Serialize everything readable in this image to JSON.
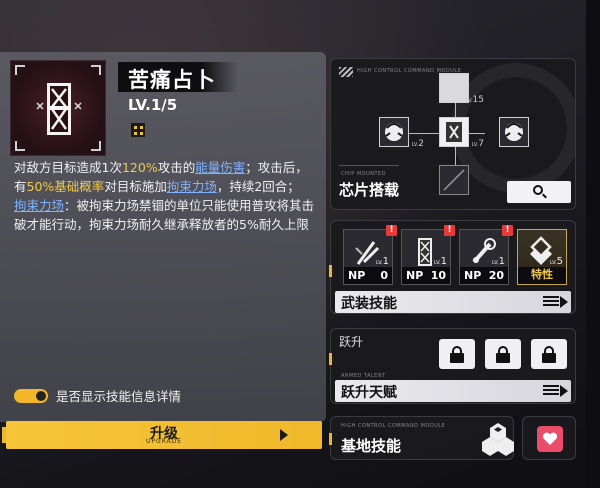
{
  "skill": {
    "title": "苦痛占卜",
    "level": "LV.1/5",
    "desc": {
      "p1": "对敌方目标造成1次",
      "p2": "120%",
      "p3": "攻击的",
      "p4": "能量伤害",
      "p5": "；攻击后，有",
      "p6": "50%基础概率",
      "p7": "对目标施加",
      "p8": "拘束力场",
      "p9": "，持续2回合；",
      "p10": "拘束力场",
      "p11": "：被拘束力场禁锢的单位只能使用普攻将其击破才能行动，拘束力场耐久继承释放者的5%耐久上限"
    },
    "toggle_label": "是否显示技能信息详情",
    "upgrade_label": "升级",
    "upgrade_sub": "UPGRADE"
  },
  "chip": {
    "caption_top": "HIGH CONTROL COMMAND MODULE",
    "caption_mounted": "CHIP MOUNTED",
    "title": "芯片搭载",
    "nodes": [
      {
        "level": "15"
      },
      {
        "level": "2"
      },
      {
        "level": "7"
      }
    ],
    "lv_prefix": "LV."
  },
  "weapon": {
    "cards": [
      {
        "lv": "1",
        "np_label": "NP",
        "np_value": "0",
        "alert": "!"
      },
      {
        "lv": "1",
        "np_label": "NP",
        "np_value": "10",
        "alert": "!"
      },
      {
        "lv": "1",
        "np_label": "NP",
        "np_value": "20",
        "alert": "!"
      },
      {
        "lv": "5",
        "trait": "特性"
      }
    ],
    "lv_prefix": "LV.",
    "section_title": "武装技能"
  },
  "ascend": {
    "title": "跃升",
    "caption": "ARMED TALENT",
    "section_title": "跃升天赋"
  },
  "base": {
    "caption": "HIGH CONTROL COMMAND MODULE",
    "title": "基地技能"
  },
  "colors": {
    "accent": "#f2c040",
    "link": "#7fb2ff",
    "alert": "#e83838",
    "heart": "#e94d6a"
  }
}
